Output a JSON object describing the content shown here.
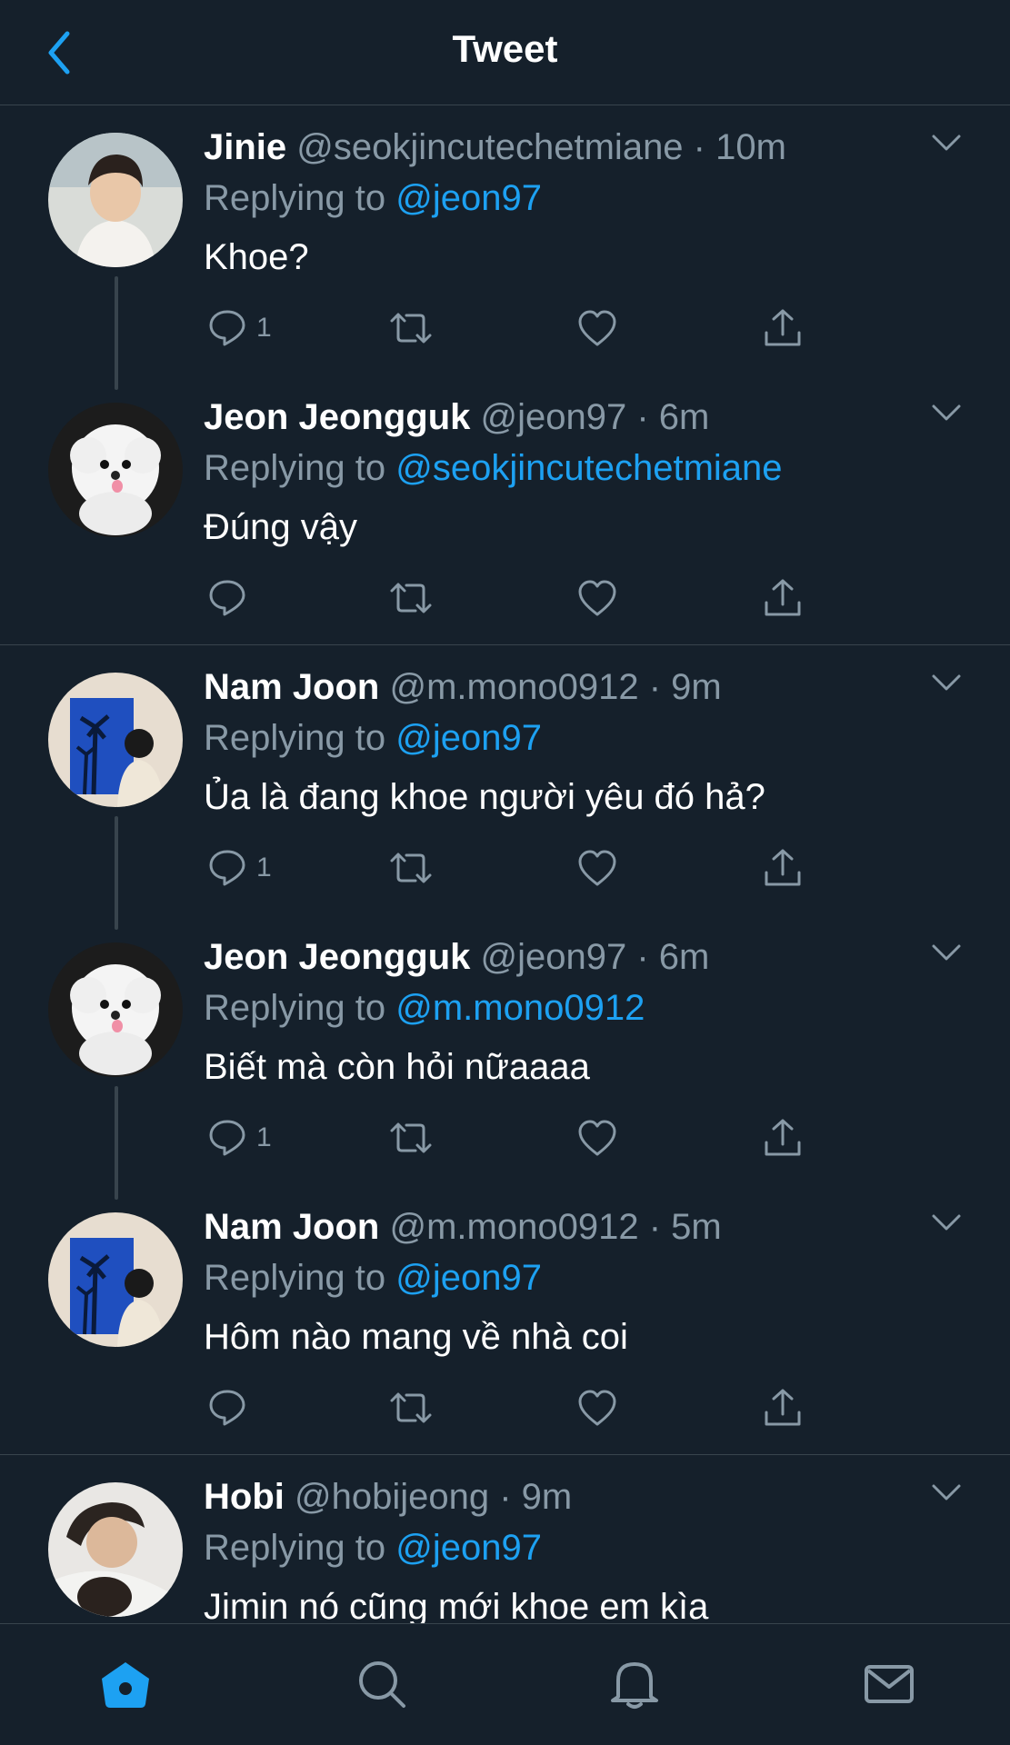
{
  "header": {
    "title": "Tweet"
  },
  "colors": {
    "background": "#15202b",
    "accent": "#1da1f2",
    "muted": "#8899a6",
    "divider": "#38444d"
  },
  "tweets": [
    {
      "name": "Jinie",
      "handle": "@seokjincutechetmiane",
      "time": "10m",
      "reply_prefix": "Replying to",
      "reply_to": "@jeon97",
      "text": "Khoe?",
      "reply_count": "1"
    },
    {
      "name": "Jeon Jeongguk",
      "handle": "@jeon97",
      "time": "6m",
      "reply_prefix": "Replying to",
      "reply_to": "@seokjincutechetmiane",
      "text": "Đúng vậy",
      "reply_count": ""
    },
    {
      "name": "Nam Joon",
      "handle": "@m.mono0912",
      "time": "9m",
      "reply_prefix": "Replying to",
      "reply_to": "@jeon97",
      "text": "Ủa là đang khoe người yêu đó hả?",
      "reply_count": "1"
    },
    {
      "name": "Jeon Jeongguk",
      "handle": "@jeon97",
      "time": "6m",
      "reply_prefix": "Replying to",
      "reply_to": "@m.mono0912",
      "text": "Biết mà còn hỏi nữaaaa",
      "reply_count": "1"
    },
    {
      "name": "Nam Joon",
      "handle": "@m.mono0912",
      "time": "5m",
      "reply_prefix": "Replying to",
      "reply_to": "@jeon97",
      "text": "Hôm nào mang về nhà coi",
      "reply_count": ""
    },
    {
      "name": "Hobi",
      "handle": "@hobijeong",
      "time": "9m",
      "reply_prefix": "Replying to",
      "reply_to": "@jeon97",
      "text": "Jimin nó cũng mới khoe em kìa",
      "reply_count": ""
    }
  ],
  "tabs": [
    "home-icon",
    "search-icon",
    "notifications-icon",
    "messages-icon"
  ]
}
